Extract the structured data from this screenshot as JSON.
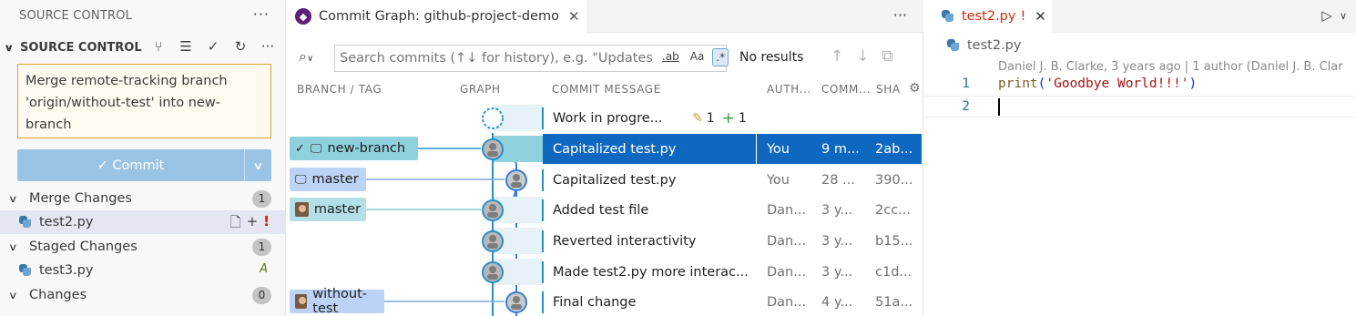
{
  "sidebar": {
    "header": "SOURCE CONTROL",
    "section_title": "SOURCE CONTROL",
    "commit_message": "Merge remote-tracking branch\n'origin/without-test' into new-\nbranch",
    "commit_button": "Commit",
    "groups": [
      {
        "label": "Merge Changes",
        "count": "1"
      },
      {
        "label": "Staged Changes",
        "count": "1"
      },
      {
        "label": "Changes",
        "count": "0"
      }
    ],
    "merge_file": {
      "name": "test2.py",
      "status": "!"
    },
    "staged_file": {
      "name": "test3.py",
      "status": "A"
    }
  },
  "graph": {
    "tab_title": "Commit Graph: github-project-demo",
    "search_placeholder": "Search commits (↑↓ for history), e.g. \"Updates d",
    "search_opts": [
      ".ab",
      "Aa",
      ".*"
    ],
    "no_results": "No results",
    "columns": {
      "branch": "BRANCH / TAG",
      "graph": "GRAPH",
      "message": "COMMIT MESSAGE",
      "author": "AUTH...",
      "date": "COMM...",
      "sha": "SHA"
    },
    "wip": {
      "message": "Work in progre...",
      "modified": "1",
      "added": "1"
    },
    "rows": [
      {
        "branch": "new-branch",
        "message": "Capitalized test.py",
        "author": "You",
        "date": "9 m...",
        "sha": "2ab..."
      },
      {
        "branch": "master",
        "message": "Capitalized test.py",
        "author": "You",
        "date": "28 ...",
        "sha": "390..."
      },
      {
        "branch": "master",
        "message": "Added test file",
        "author": "Dan...",
        "date": "3 y...",
        "sha": "2cc..."
      },
      {
        "branch": "",
        "message": "Reverted interactivity",
        "author": "Dan...",
        "date": "3 y...",
        "sha": "b15..."
      },
      {
        "branch": "",
        "message": "Made test2.py more interac...",
        "author": "Dan...",
        "date": "3 y...",
        "sha": "c1d..."
      },
      {
        "branch": "without-test",
        "message": "Final change",
        "author": "Dan...",
        "date": "4 y...",
        "sha": "51a..."
      }
    ]
  },
  "editor": {
    "tab_title": "test2.py",
    "tab_flag": "!",
    "breadcrumb": "test2.py",
    "blame": "Daniel J. B. Clarke, 3 years ago | 1 author (Daniel J. B. Clar",
    "lines": [
      {
        "num": "1",
        "fn": "print",
        "open": "(",
        "str": "'Goodbye World!!!'",
        "close": ")"
      },
      {
        "num": "2"
      }
    ]
  },
  "colors": {
    "accent": "#0f68c0",
    "commit_button": "#9ac4e5",
    "conflict": "#e51400",
    "graph_line": "#2a8fc9",
    "added": "#587c0c"
  }
}
